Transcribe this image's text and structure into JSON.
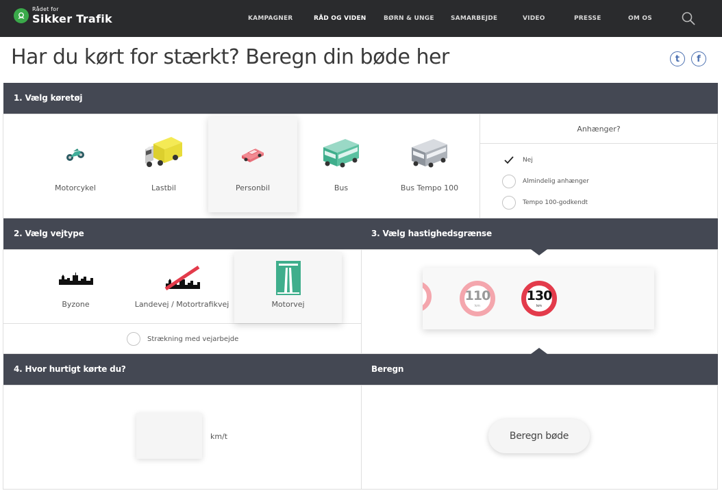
{
  "nav": {
    "brand_small": "Rådet for",
    "brand_big": "Sikker Trafik",
    "items": [
      {
        "label": "KAMPAGNER"
      },
      {
        "label": "RÅD OG VIDEN"
      },
      {
        "label": "BØRN & UNGE"
      },
      {
        "label": "SAMARBEJDE"
      },
      {
        "label": "VIDEO"
      },
      {
        "label": "PRESSE"
      },
      {
        "label": "OM OS"
      }
    ],
    "active_item": "RÅD OG VIDEN"
  },
  "page": {
    "title": "Har du kørt for stærkt? Beregn din bøde her",
    "share_tumblr": "t",
    "share_facebook": "f"
  },
  "step1": {
    "heading": "1. Vælg køretøj",
    "vehicles": [
      {
        "label": "Motorcykel",
        "icon": "motorcycle-icon"
      },
      {
        "label": "Lastbil",
        "icon": "truck-icon"
      },
      {
        "label": "Personbil",
        "icon": "car-icon"
      },
      {
        "label": "Bus",
        "icon": "bus-icon"
      },
      {
        "label": "Bus Tempo 100",
        "icon": "bus-tempo-100-icon"
      }
    ],
    "selected_vehicle": "Personbil",
    "trailer": {
      "heading": "Anhænger?",
      "options": [
        {
          "label": "Nej",
          "checked": true
        },
        {
          "label": "Almindelig anhænger",
          "checked": false
        },
        {
          "label": "Tempo 100-godkendt",
          "checked": false
        }
      ]
    }
  },
  "step2": {
    "heading": "2. Vælg vejtype",
    "roads": [
      {
        "label": "Byzone",
        "icon": "city-skyline-icon"
      },
      {
        "label": "Landevej / Motortrafikvej",
        "icon": "city-exit-icon"
      },
      {
        "label": "Motorvej",
        "icon": "motorway-sign-icon"
      }
    ],
    "selected_road": "Motorvej",
    "roadwork_label": "Strækning med vejarbejde"
  },
  "step3": {
    "heading": "3. Vælg hastighedsgrænse",
    "limits": [
      {
        "value": "110",
        "unit": "km"
      },
      {
        "value": "130",
        "unit": "km"
      }
    ],
    "selected_limit": "130"
  },
  "step4": {
    "heading": "4. Hvor hurtigt kørte du?",
    "input_value": "",
    "unit": "km/t"
  },
  "calc": {
    "heading": "Beregn",
    "button_label": "Beregn bøde"
  },
  "colors": {
    "nav_bg": "#2a2b2d",
    "header_bg": "#444853",
    "brand_green": "#3aa94a",
    "sign_red": "#e33b4b",
    "motorway_green": "#3fae8c"
  }
}
